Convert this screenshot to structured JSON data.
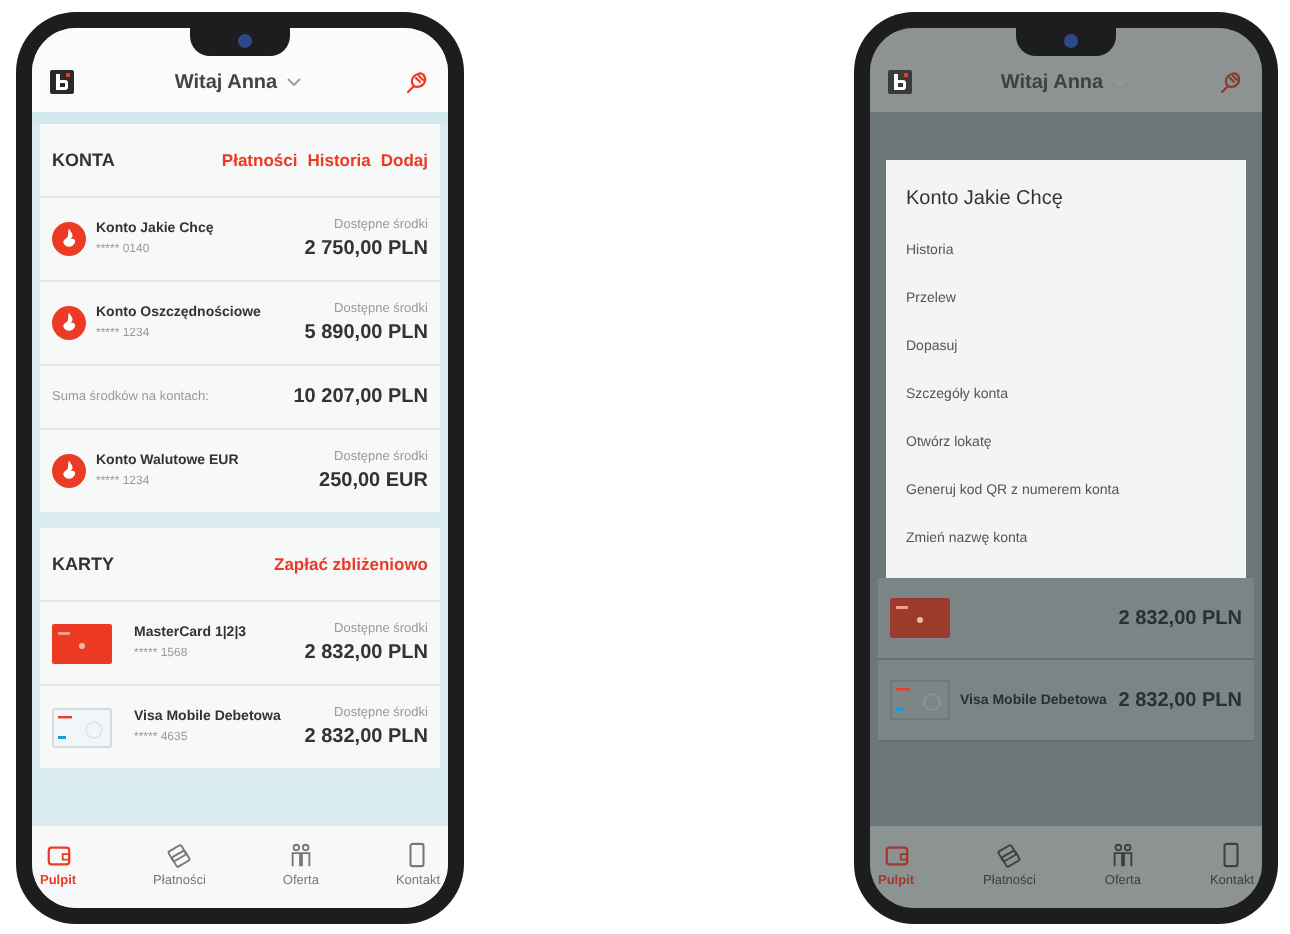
{
  "left_phone": {
    "header": {
      "greeting": "Witaj Anna"
    },
    "accounts": {
      "title": "KONTA",
      "links": [
        "Płatności",
        "Historia",
        "Dodaj"
      ],
      "rows": [
        {
          "kind": "account",
          "name": "Konto Jakie Chcę",
          "number": "***** 0140",
          "label": "Dostępne środki",
          "amount": "2 750,00 PLN"
        },
        {
          "kind": "account",
          "name": "Konto Oszczędnościowe",
          "number": "***** 1234",
          "label": "Dostępne środki",
          "amount": "5 890,00 PLN"
        },
        {
          "kind": "total",
          "label": "Suma środków na kontach:",
          "amount": "10 207,00 PLN"
        },
        {
          "kind": "account",
          "name": "Konto Walutowe EUR",
          "number": "***** 1234",
          "label": "Dostępne środki",
          "amount": "250,00 EUR"
        }
      ]
    },
    "cards": {
      "title": "KARTY",
      "link": "Zapłać zbliżeniowo",
      "rows": [
        {
          "kind": "mastercard",
          "name": "MasterCard 1|2|3",
          "number": "***** 1568",
          "label": "Dostępne środki",
          "amount": "2 832,00 PLN"
        },
        {
          "kind": "visa",
          "name": "Visa Mobile Debetowa",
          "number": "***** 4635",
          "label": "Dostępne środki",
          "amount": "2 832,00 PLN"
        }
      ]
    },
    "tabs": [
      {
        "label": "Pulpit",
        "selected": true
      },
      {
        "label": "Płatności",
        "selected": false
      },
      {
        "label": "Oferta",
        "selected": false
      },
      {
        "label": "Kontakt",
        "selected": false
      }
    ]
  },
  "right_phone": {
    "header": {
      "greeting": "Witaj Anna"
    },
    "menu": {
      "title": "Konto Jakie Chcę",
      "items": [
        "Historia",
        "Przelew",
        "Dopasuj",
        "Szczegóły konta",
        "Otwórz lokatę",
        "Generuj kod QR z numerem konta",
        "Zmień nazwę konta"
      ]
    },
    "cards": [
      {
        "kind": "mastercard",
        "amount": "2 832,00 PLN"
      },
      {
        "kind": "visa",
        "name": "Visa Mobile Debetowa",
        "amount": "2 832,00 PLN"
      }
    ],
    "tabs": [
      {
        "label": "Pulpit",
        "selected": true
      },
      {
        "label": "Płatności",
        "selected": false
      },
      {
        "label": "Oferta",
        "selected": false
      },
      {
        "label": "Kontakt",
        "selected": false
      }
    ]
  }
}
